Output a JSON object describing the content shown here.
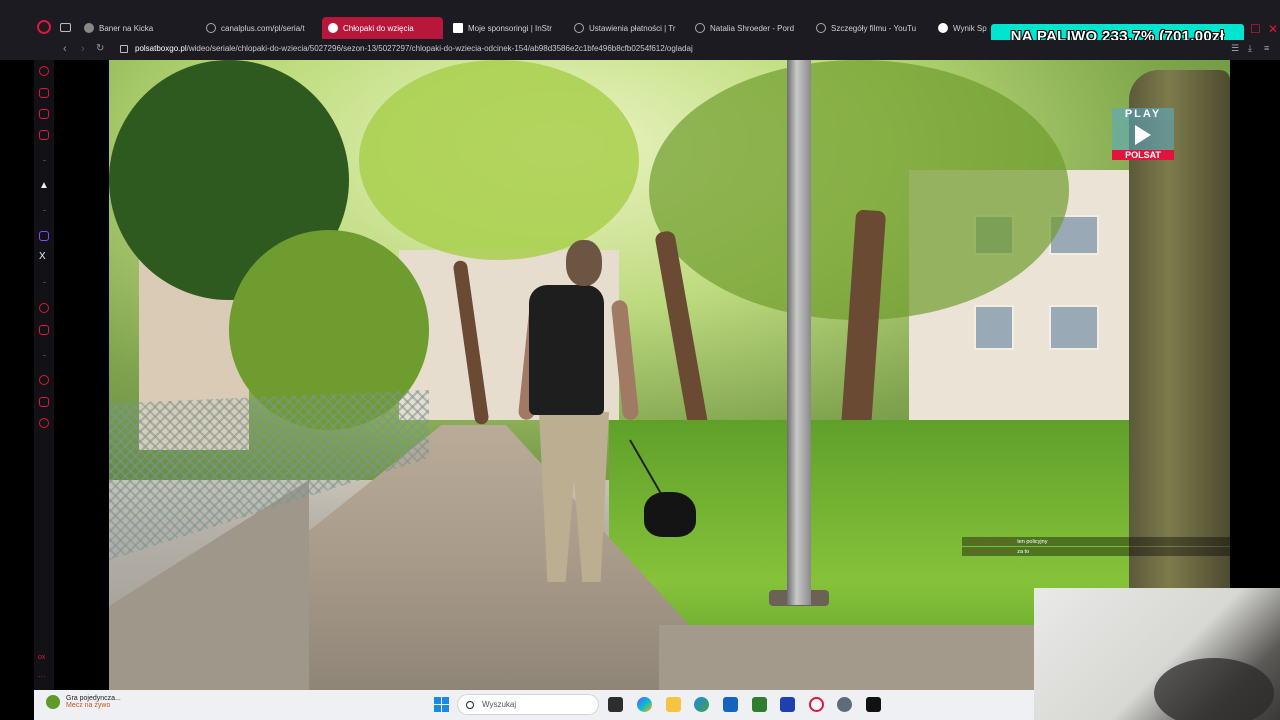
{
  "browser": {
    "tabs": [
      {
        "label": "Baner na Kicka",
        "color": "#888888"
      },
      {
        "label": "canalplus.com/pl/seria/t",
        "color": "#aaaaaa"
      },
      {
        "label": "Chłopaki do wzięcia",
        "color": "#ffffff",
        "active": true
      },
      {
        "label": "Moje sponsoringi | InStr",
        "color": "#ffffff"
      },
      {
        "label": "Ustawienia płatności | Tr",
        "color": "#aaaaaa"
      },
      {
        "label": "Natalia Shroeder - Pord",
        "color": "#aaaaaa"
      },
      {
        "label": "Szczegóły filmu - YouTu",
        "color": "#aaaaaa"
      },
      {
        "label": "Wynik Sp",
        "color": "#ffffff"
      }
    ],
    "url_host": "polsatboxgo.pl",
    "url_path": "/wideo/seriale/chlopaki-do-wziecia/5027296/sezon-13/5027297/chlopaki-do-wziecia-odcinek-154/ab98d3586e2c1bfe496b8cfb0254f612/ogladaj"
  },
  "overlay": {
    "banner_text": "NA PALIWO 233.7% (701.00zł",
    "brand_color": "#e0143c",
    "banner_color": "#00e5d0"
  },
  "player": {
    "logo_top": "PLAY",
    "logo_bottom": "POLSAT",
    "chat": [
      {
        "user": "~~~~~~~~~~~~~~~",
        "text": "ten policyjny"
      },
      {
        "user": "~~~~~~~~~~~~~~~",
        "text": "za to"
      }
    ]
  },
  "taskbar": {
    "notification_title": "Gra pojedyncza...",
    "notification_sub": "Mecz na żywo",
    "search_placeholder": "Wyszukaj"
  },
  "sidebar": {
    "x_label": "X",
    "bottom_label": "ox"
  }
}
